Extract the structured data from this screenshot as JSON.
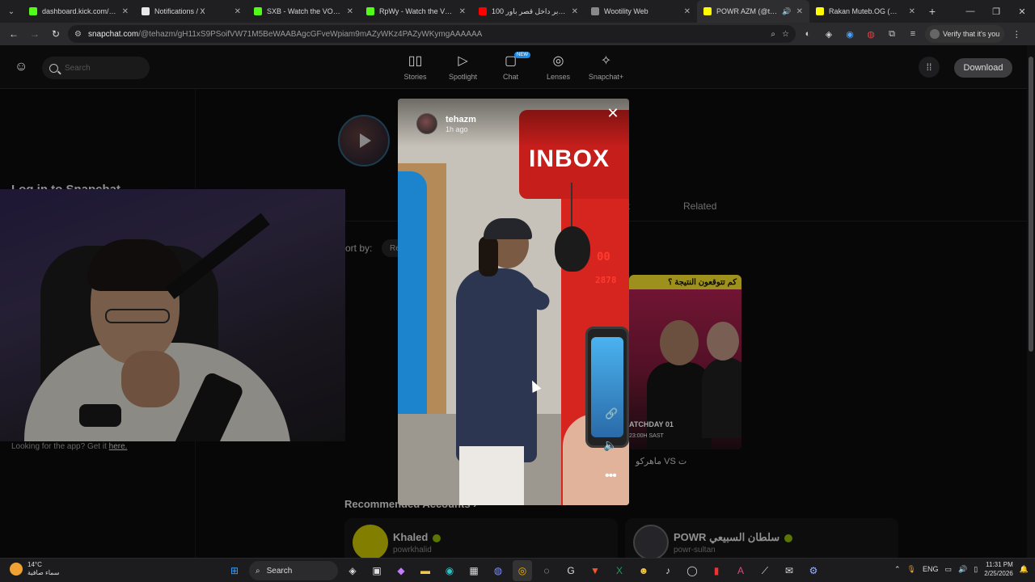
{
  "browser": {
    "tabs": [
      {
        "title": "dashboard.kick.com/strea",
        "color": "#53fc18",
        "active": false
      },
      {
        "title": "Notifications / X",
        "color": "#e8e8e8",
        "active": false
      },
      {
        "title": "SXB - Watch the VOD on K",
        "color": "#53fc18",
        "active": false
      },
      {
        "title": "RpWy - Watch the VOD on",
        "color": "#53fc18",
        "active": false
      },
      {
        "title": "100 يوتيوبر داخل قصر باور",
        "color": "#ff0000",
        "active": false
      },
      {
        "title": "Wootility Web",
        "color": "#888888",
        "active": false
      },
      {
        "title": "POWR AZM (@tehazm)",
        "color": "#fffc00",
        "active": true
      },
      {
        "title": "Rakan Muteb.OG (@rms...",
        "color": "#fffc00",
        "active": false
      }
    ],
    "url_host": "snapchat.com",
    "url_path": "/@tehazm/gH11xS9PSoifVW71M5BeWAABAgcGFveWpiam9mAZyWKz4PAZyWKymgAAAAAA",
    "verify_label": "Verify that it's you"
  },
  "snap_header": {
    "search_placeholder": "Search",
    "nav": [
      {
        "label": "Stories",
        "icon": "stories-icon",
        "glyph": "▯▯"
      },
      {
        "label": "Spotlight",
        "icon": "spotlight-icon",
        "glyph": "▷"
      },
      {
        "label": "Chat",
        "icon": "chat-icon",
        "glyph": "▢",
        "badge": "NEW"
      },
      {
        "label": "Lenses",
        "icon": "lenses-icon",
        "glyph": "◎"
      },
      {
        "label": "Snapchat+",
        "icon": "snapchat-plus-icon",
        "glyph": "✧"
      }
    ],
    "download_label": "Download"
  },
  "left": {
    "login_heading": "Log in to Snapchat",
    "getapp_text": "Looking for the app? Get it ",
    "getapp_link": "here."
  },
  "profile": {
    "tab_partial": "t",
    "tab_related": "Related",
    "sort_label": "ort by:",
    "sort_value": "Re"
  },
  "thumb": {
    "banner": "كم تتوقعون النتيجة ؟",
    "line1": "ATCHDAY 01",
    "line2": "23:00H SAST",
    "caption": "ماهركو VS ت"
  },
  "recommended": {
    "title": "Recommended Accounts ›",
    "cards": [
      {
        "name": "Khaled",
        "handle": "powrkhalid",
        "avatar_color": "#c8c400"
      },
      {
        "name": "POWR سلطان السبيعي",
        "handle": "powr-sultan",
        "avatar_color": "#3a3a40"
      }
    ]
  },
  "story": {
    "username": "tehazm",
    "time": "1h ago",
    "machine_text": "INBOX",
    "digits1": "00",
    "digits2": "2878"
  },
  "taskbar": {
    "temp": "14°C",
    "weather_text": "سماء صافية",
    "search_label": "Search",
    "lang": "ENG",
    "time": "11:31 PM",
    "date": "2/25/2026"
  }
}
